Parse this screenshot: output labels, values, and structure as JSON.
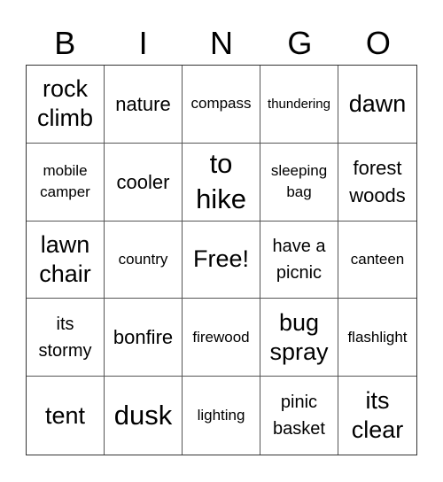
{
  "header": {
    "letters": [
      "B",
      "I",
      "N",
      "G",
      "O"
    ]
  },
  "cells": [
    [
      "rock climb",
      "nature",
      "compass",
      "thundering",
      "dawn"
    ],
    [
      "mobile camper",
      "cooler",
      "to hike",
      "sleeping bag",
      "forest woods"
    ],
    [
      "lawn chair",
      "country",
      "Free!",
      "have a picnic",
      "canteen"
    ],
    [
      "its stormy",
      "bonfire",
      "firewood",
      "bug spray",
      "flashlight"
    ],
    [
      "tent",
      "dusk",
      "lighting",
      "pinic basket",
      "its clear"
    ]
  ]
}
